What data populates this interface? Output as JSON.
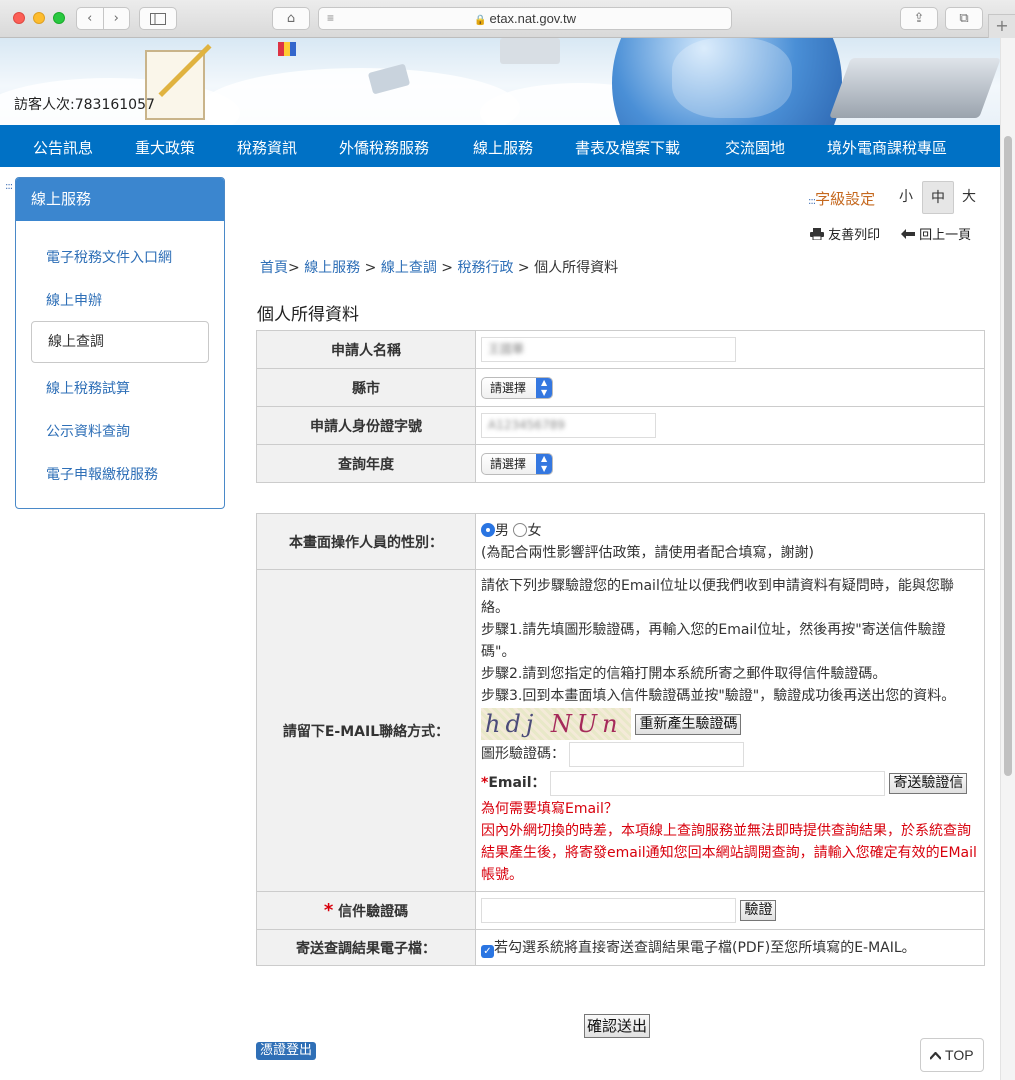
{
  "browser": {
    "url": "etax.nat.gov.tw",
    "back_icon": "‹",
    "forward_icon": "›",
    "home_icon": "⌂",
    "share_icon": "⇪",
    "tabs_icon": "⧉",
    "new_tab_icon": "+"
  },
  "banner": {
    "visitor_count": "訪客人次:783161057"
  },
  "main_nav": [
    {
      "label": "公告訊息"
    },
    {
      "label": "重大政策"
    },
    {
      "label": "稅務資訊"
    },
    {
      "label": "外僑稅務服務"
    },
    {
      "label": "線上服務"
    },
    {
      "label": "書表及檔案下載"
    },
    {
      "label": "交流園地"
    },
    {
      "label": "境外電商課稅專區"
    }
  ],
  "sidebar": {
    "marker": ":::",
    "title": "線上服務",
    "items": [
      {
        "label": "電子稅務文件入口網"
      },
      {
        "label": "線上申辦"
      },
      {
        "label": "線上查調"
      },
      {
        "label": "線上稅務試算"
      },
      {
        "label": "公示資料查詢"
      },
      {
        "label": "電子申報繳稅服務"
      }
    ]
  },
  "toolbar": {
    "font_marker": ":::",
    "font_label": "字級設定",
    "font_small": "小",
    "font_medium": "中",
    "font_large": "大",
    "print_label": "友善列印",
    "back_label": "回上一頁"
  },
  "breadcrumb": {
    "home": "首頁",
    "online_service": "線上服務",
    "online_query": "線上查調",
    "tax_admin": "稅務行政",
    "current": "個人所得資料",
    "separator": ">"
  },
  "page_title": "個人所得資料",
  "form1": {
    "applicant_name_label": "申請人名稱",
    "applicant_name_value": "王國華",
    "city_label": "縣市",
    "city_value": "請選擇",
    "id_label": "申請人身份證字號",
    "id_value": "A123456789",
    "year_label": "查詢年度",
    "year_value": "請選擇"
  },
  "form2": {
    "gender_label": "本畫面操作人員的性別：",
    "gender_male": "男",
    "gender_female": "女",
    "gender_note": "(為配合兩性影響評估政策，請使用者配合填寫，謝謝)",
    "email_label": "請留下E-MAIL聯絡方式：",
    "email_intro": "請依下列步驟驗證您的Email位址以便我們收到申請資料有疑問時，能與您聯絡。",
    "step1": "步驟1.請先填圖形驗證碼，再輸入您的Email位址，然後再按\"寄送信件驗證碼\"。",
    "step2": "步驟2.請到您指定的信箱打開本系統所寄之郵件取得信件驗證碼。",
    "step3": "步驟3.回到本畫面填入信件驗證碼並按\"驗證\"，驗證成功後再送出您的資料。",
    "captcha_text_a": "hdj",
    "captcha_text_b": "NUn",
    "regen_button": "重新產生驗證碼",
    "captcha_label": "圖形驗證碼：",
    "email_star": "*",
    "email_field_label": "Email：",
    "send_code_button": "寄送驗證信",
    "why_title": "為何需要填寫Email？",
    "why_text": "因內外網切換的時差，本項線上查詢服務並無法即時提供查詢結果，於系統查詢結果產生後，將寄發email通知您回本網站調閱查詢，請輸入您確定有效的EMail帳號。",
    "mail_code_star": "*",
    "mail_code_label": "信件驗證碼",
    "verify_button": "驗證",
    "send_file_label": "寄送查調結果電子檔：",
    "send_file_text": "若勾選系統將直接寄送查調結果電子檔(PDF)至您所填寫的E-MAIL。"
  },
  "submit_button": "確認送出",
  "logout_button": "憑證登出",
  "top_button": "TOP",
  "colors": {
    "nav_blue": "#0071c5",
    "sidebar_header": "#3b86cf",
    "link_blue": "#2e6fb7",
    "alert_red": "#d8000c",
    "font_setting_orange": "#c5681e"
  }
}
